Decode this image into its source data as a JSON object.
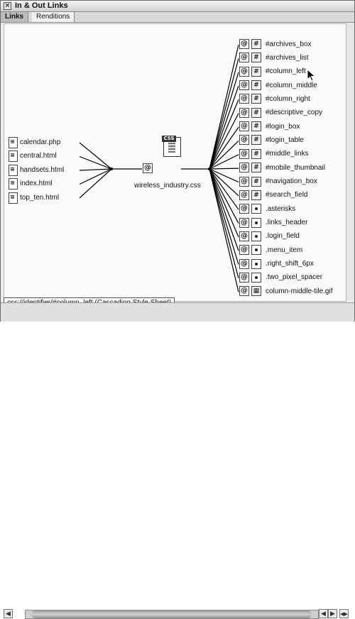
{
  "window": {
    "title": "In & Out Links",
    "close_glyph": "×"
  },
  "tabs": [
    {
      "label": "Links",
      "active": true
    },
    {
      "label": "Renditions",
      "active": false
    }
  ],
  "center": {
    "label": "wireless_industry.css",
    "icon": "css-document-icon",
    "badge": "CSS"
  },
  "incoming": [
    {
      "label": "calendar.php",
      "icon": "html-file-icon"
    },
    {
      "label": "central.html",
      "icon": "html-file-icon"
    },
    {
      "label": "handsets.html",
      "icon": "html-file-icon"
    },
    {
      "label": "index.html",
      "icon": "html-file-icon"
    },
    {
      "label": "top_ten.html",
      "icon": "html-file-icon"
    }
  ],
  "outgoing": [
    {
      "label": "#archives_box",
      "kind": "id"
    },
    {
      "label": "#archives_list",
      "kind": "id"
    },
    {
      "label": "#column_left",
      "kind": "id"
    },
    {
      "label": "#column_middle",
      "kind": "id"
    },
    {
      "label": "#column_right",
      "kind": "id"
    },
    {
      "label": "#descriptive_copy",
      "kind": "id"
    },
    {
      "label": "#login_box",
      "kind": "id"
    },
    {
      "label": "#login_table",
      "kind": "id"
    },
    {
      "label": "#middle_links",
      "kind": "id"
    },
    {
      "label": "#mobile_thumbnail",
      "kind": "id"
    },
    {
      "label": "#navigation_box",
      "kind": "id"
    },
    {
      "label": "#search_field",
      "kind": "id"
    },
    {
      "label": ".asterisks",
      "kind": "class"
    },
    {
      "label": ".links_header",
      "kind": "class"
    },
    {
      "label": ".login_field",
      "kind": "class"
    },
    {
      "label": ".menu_item",
      "kind": "class"
    },
    {
      "label": ".right_shift_6px",
      "kind": "class"
    },
    {
      "label": ".two_pixel_spacer",
      "kind": "class"
    },
    {
      "label": "column-middle-tile.gif",
      "kind": "image"
    }
  ],
  "status": {
    "tooltip": "css://identifier/#column_left (Cascading Style Sheet)"
  },
  "scrollbar": {
    "left_glyph": "◀",
    "right_glyph": "▶",
    "corner_glyph": "◀▶"
  },
  "colors": {
    "background": "#ededed",
    "canvas": "#fafafa",
    "line": "#000000"
  }
}
